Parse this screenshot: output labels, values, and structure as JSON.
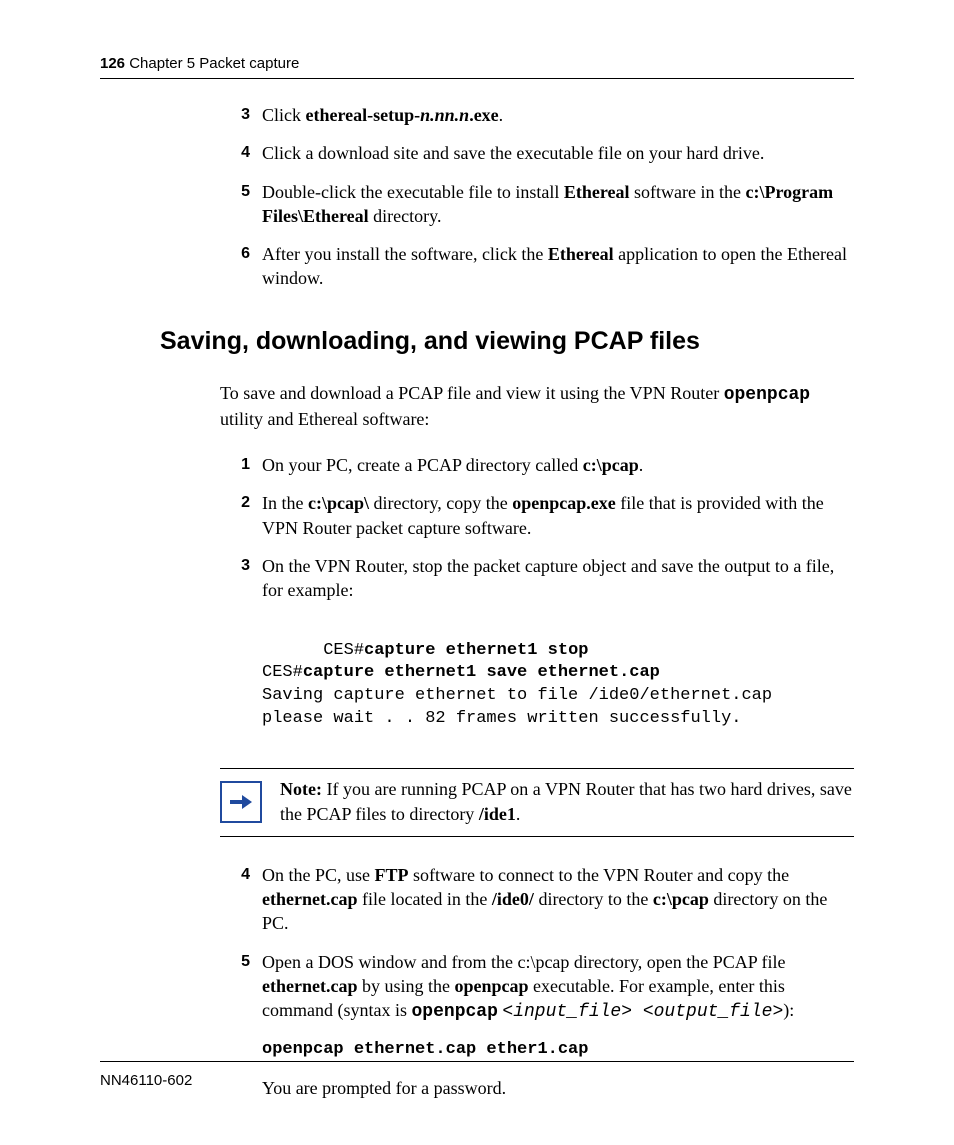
{
  "header": {
    "page_number": "126",
    "chapter": "Chapter 5  Packet capture"
  },
  "top_steps": [
    {
      "num": "3",
      "html": "Click <b>ethereal-setup-<i>n.nn.n</i>.exe</b>."
    },
    {
      "num": "4",
      "html": "Click a download site and save the executable file on your hard drive."
    },
    {
      "num": "5",
      "html": "Double-click the executable file to install <b>Ethereal</b> software in the <b>c:\\Program Files\\Ethereal</b> directory."
    },
    {
      "num": "6",
      "html": "After you install the software, click the <b>Ethereal</b> application to open the Ethereal window."
    }
  ],
  "section_heading": "Saving, downloading, and viewing PCAP files",
  "intro_html": "To save and download a PCAP file and view it using the VPN Router <span class=\"mono\">openpcap</span> utility and Ethereal software:",
  "steps_a": [
    {
      "num": "1",
      "html": "On your PC, create a PCAP directory called <b>c:\\pcap</b>."
    },
    {
      "num": "2",
      "html": "In the <b>c:\\pcap\\</b> directory, copy the <b>openpcap.exe</b> file that is provided with the VPN Router packet capture software."
    },
    {
      "num": "3",
      "html": "On the VPN Router, stop the packet capture object and save the output to a file, for example:"
    }
  ],
  "code_block_html": "<span>CES#</span><b>capture ethernet1 stop</b>\n<span>CES#</span><b>capture ethernet1 save ethernet.cap</b>\nSaving capture ethernet to file /ide0/ethernet.cap\nplease wait . . 82 frames written successfully.",
  "note_html": "<b>Note:</b> If you are running PCAP on a VPN Router that has two hard drives, save the PCAP files to directory <b>/ide1</b>.",
  "steps_b": [
    {
      "num": "4",
      "html": "On the PC, use <b>FTP</b> software to connect to the VPN Router and copy the <b>ethernet.cap</b> file located in the <b>/ide0/</b> directory to the <b>c:\\pcap</b> directory on the PC."
    },
    {
      "num": "5",
      "html": "Open a DOS window and from the c:\\pcap directory, open the PCAP file <b>ethernet.cap</b> by using the <b>openpcap</b> executable. For example, enter this command (syntax is <span class=\"mono\">openpcap</span> <span class=\"mono-italic\">&lt;input_file&gt; &lt;output_file&gt;</span>):"
    }
  ],
  "cmd_line": "openpcap ethernet.cap ether1.cap",
  "post_cmd_text": "You are prompted for a password.",
  "footer": {
    "doc_id": "NN46110-602"
  }
}
